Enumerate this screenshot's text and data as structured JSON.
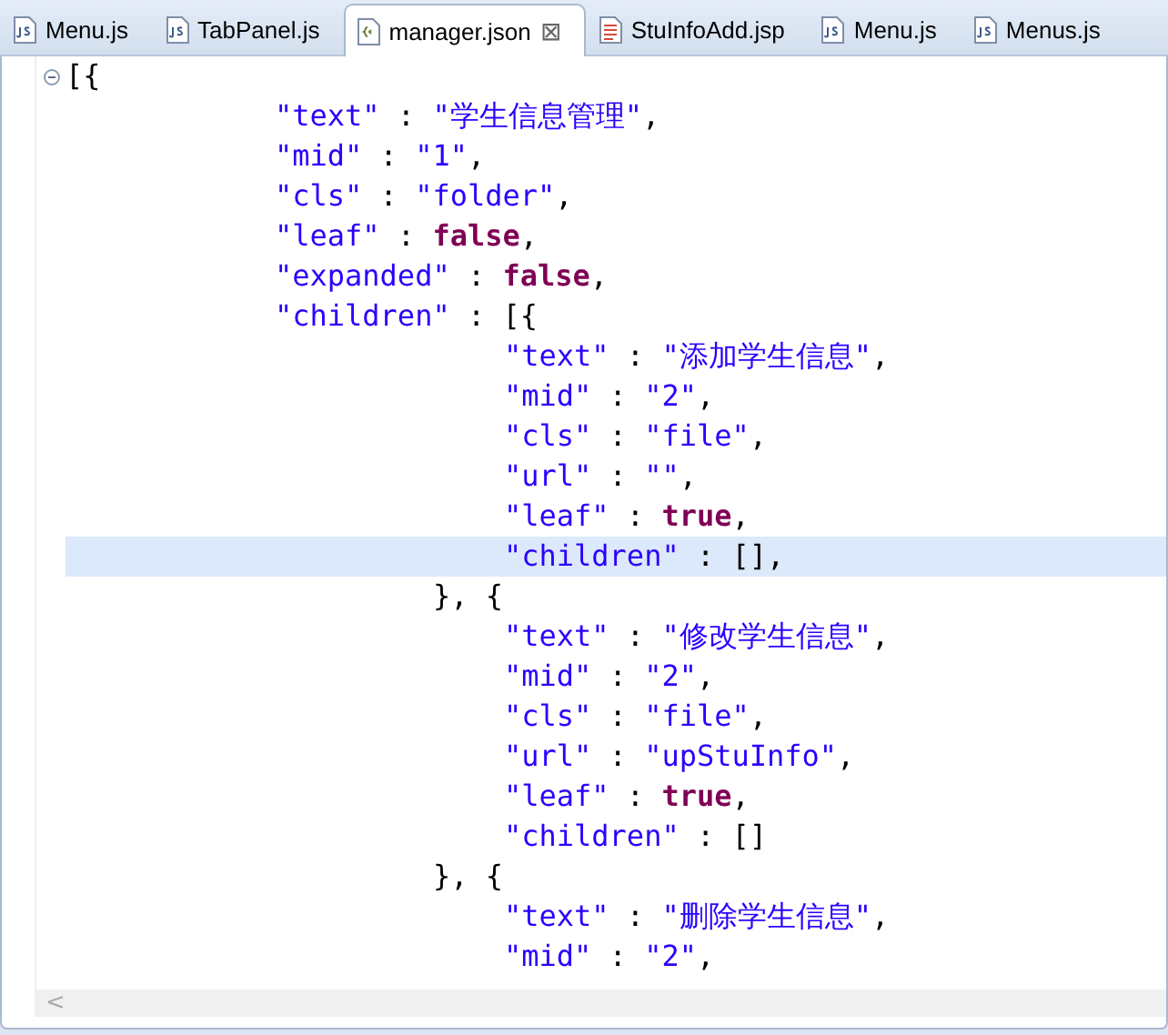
{
  "tabs": [
    {
      "label": "Menu.js",
      "kind": "js",
      "selected": false
    },
    {
      "label": "TabPanel.js",
      "kind": "js",
      "selected": false
    },
    {
      "label": "manager.json",
      "kind": "json",
      "selected": true,
      "close": "⊠"
    },
    {
      "label": "StuInfoAdd.jsp",
      "kind": "jsp",
      "selected": false
    },
    {
      "label": "Menu.js",
      "kind": "js",
      "selected": false
    },
    {
      "label": "Menus.js",
      "kind": "js",
      "selected": false
    }
  ],
  "editor": {
    "lines": [
      {
        "kind": "code",
        "fold_expanded": true,
        "current": false,
        "tokens": [
          {
            "kind": "punct",
            "text": "[{"
          }
        ],
        "children": [
          {
            "kind": "code",
            "current": false,
            "tokens": [
              {
                "kind": "key",
                "text": "\"text\""
              },
              {
                "kind": "punct",
                "text": " : "
              },
              {
                "kind": "string",
                "text": "\"学生信息管理\""
              },
              {
                "kind": "punct",
                "text": ","
              }
            ]
          },
          {
            "kind": "code",
            "current": false,
            "tokens": [
              {
                "kind": "key",
                "text": "\"mid\""
              },
              {
                "kind": "punct",
                "text": " : "
              },
              {
                "kind": "string",
                "text": "\"1\""
              },
              {
                "kind": "punct",
                "text": ","
              }
            ]
          },
          {
            "kind": "code",
            "current": false,
            "tokens": [
              {
                "kind": "key",
                "text": "\"cls\""
              },
              {
                "kind": "punct",
                "text": " : "
              },
              {
                "kind": "string",
                "text": "\"folder\""
              },
              {
                "kind": "punct",
                "text": ","
              }
            ]
          },
          {
            "kind": "code",
            "current": false,
            "tokens": [
              {
                "kind": "key",
                "text": "\"leaf\""
              },
              {
                "kind": "punct",
                "text": " : "
              },
              {
                "kind": "keyword",
                "text": "false"
              },
              {
                "kind": "punct",
                "text": ","
              }
            ]
          },
          {
            "kind": "code",
            "current": false,
            "tokens": [
              {
                "kind": "key",
                "text": "\"expanded\""
              },
              {
                "kind": "punct",
                "text": " : "
              },
              {
                "kind": "keyword",
                "text": "false"
              },
              {
                "kind": "punct",
                "text": ","
              }
            ]
          },
          {
            "kind": "code",
            "current": false,
            "tokens": [
              {
                "kind": "key",
                "text": "\"children\""
              },
              {
                "kind": "punct",
                "text": " : [{"
              }
            ],
            "children": [
              {
                "kind": "code",
                "current": false,
                "tokens": [
                  {
                    "kind": "key",
                    "text": "\"text\""
                  },
                  {
                    "kind": "punct",
                    "text": " : "
                  },
                  {
                    "kind": "string",
                    "text": "\"添加学生信息\""
                  },
                  {
                    "kind": "punct",
                    "text": ","
                  }
                ]
              },
              {
                "kind": "code",
                "current": false,
                "tokens": [
                  {
                    "kind": "key",
                    "text": "\"mid\""
                  },
                  {
                    "kind": "punct",
                    "text": " : "
                  },
                  {
                    "kind": "string",
                    "text": "\"2\""
                  },
                  {
                    "kind": "punct",
                    "text": ","
                  }
                ]
              },
              {
                "kind": "code",
                "current": false,
                "tokens": [
                  {
                    "kind": "key",
                    "text": "\"cls\""
                  },
                  {
                    "kind": "punct",
                    "text": " : "
                  },
                  {
                    "kind": "string",
                    "text": "\"file\""
                  },
                  {
                    "kind": "punct",
                    "text": ","
                  }
                ]
              },
              {
                "kind": "code",
                "current": false,
                "tokens": [
                  {
                    "kind": "key",
                    "text": "\"url\""
                  },
                  {
                    "kind": "punct",
                    "text": " : "
                  },
                  {
                    "kind": "string",
                    "text": "\"\""
                  },
                  {
                    "kind": "punct",
                    "text": ","
                  }
                ]
              },
              {
                "kind": "code",
                "current": false,
                "tokens": [
                  {
                    "kind": "key",
                    "text": "\"leaf\""
                  },
                  {
                    "kind": "punct",
                    "text": " : "
                  },
                  {
                    "kind": "keyword",
                    "text": "true"
                  },
                  {
                    "kind": "punct",
                    "text": ","
                  }
                ]
              },
              {
                "kind": "code",
                "current": true,
                "tokens": [
                  {
                    "kind": "key",
                    "text": "\"children\""
                  },
                  {
                    "kind": "punct",
                    "text": " : [],"
                  }
                ]
              },
              {
                "kind": "brace",
                "current": false,
                "tokens": [
                  {
                    "kind": "punct",
                    "text": "}, {"
                  }
                ]
              },
              {
                "kind": "code",
                "current": false,
                "tokens": [
                  {
                    "kind": "key",
                    "text": "\"text\""
                  },
                  {
                    "kind": "punct",
                    "text": " : "
                  },
                  {
                    "kind": "string",
                    "text": "\"修改学生信息\""
                  },
                  {
                    "kind": "punct",
                    "text": ","
                  }
                ]
              },
              {
                "kind": "code",
                "current": false,
                "tokens": [
                  {
                    "kind": "key",
                    "text": "\"mid\""
                  },
                  {
                    "kind": "punct",
                    "text": " : "
                  },
                  {
                    "kind": "string",
                    "text": "\"2\""
                  },
                  {
                    "kind": "punct",
                    "text": ","
                  }
                ]
              },
              {
                "kind": "code",
                "current": false,
                "tokens": [
                  {
                    "kind": "key",
                    "text": "\"cls\""
                  },
                  {
                    "kind": "punct",
                    "text": " : "
                  },
                  {
                    "kind": "string",
                    "text": "\"file\""
                  },
                  {
                    "kind": "punct",
                    "text": ","
                  }
                ]
              },
              {
                "kind": "code",
                "current": false,
                "tokens": [
                  {
                    "kind": "key",
                    "text": "\"url\""
                  },
                  {
                    "kind": "punct",
                    "text": " : "
                  },
                  {
                    "kind": "string",
                    "text": "\"upStuInfo\""
                  },
                  {
                    "kind": "punct",
                    "text": ","
                  }
                ]
              },
              {
                "kind": "code",
                "current": false,
                "tokens": [
                  {
                    "kind": "key",
                    "text": "\"leaf\""
                  },
                  {
                    "kind": "punct",
                    "text": " : "
                  },
                  {
                    "kind": "keyword",
                    "text": "true"
                  },
                  {
                    "kind": "punct",
                    "text": ","
                  }
                ]
              },
              {
                "kind": "code",
                "current": false,
                "tokens": [
                  {
                    "kind": "key",
                    "text": "\"children\""
                  },
                  {
                    "kind": "punct",
                    "text": " : []"
                  }
                ]
              },
              {
                "kind": "brace",
                "current": false,
                "tokens": [
                  {
                    "kind": "punct",
                    "text": "}, {"
                  }
                ]
              },
              {
                "kind": "code",
                "current": false,
                "tokens": [
                  {
                    "kind": "key",
                    "text": "\"text\""
                  },
                  {
                    "kind": "punct",
                    "text": " : "
                  },
                  {
                    "kind": "string",
                    "text": "\"删除学生信息\""
                  },
                  {
                    "kind": "punct",
                    "text": ","
                  }
                ]
              },
              {
                "kind": "code",
                "current": false,
                "tokens": [
                  {
                    "kind": "key",
                    "text": "\"mid\""
                  },
                  {
                    "kind": "punct",
                    "text": " : "
                  },
                  {
                    "kind": "string",
                    "text": "\"2\""
                  },
                  {
                    "kind": "punct",
                    "text": ","
                  }
                ]
              }
            ]
          }
        ]
      }
    ],
    "scrollbar": {
      "arrow": "<"
    }
  }
}
